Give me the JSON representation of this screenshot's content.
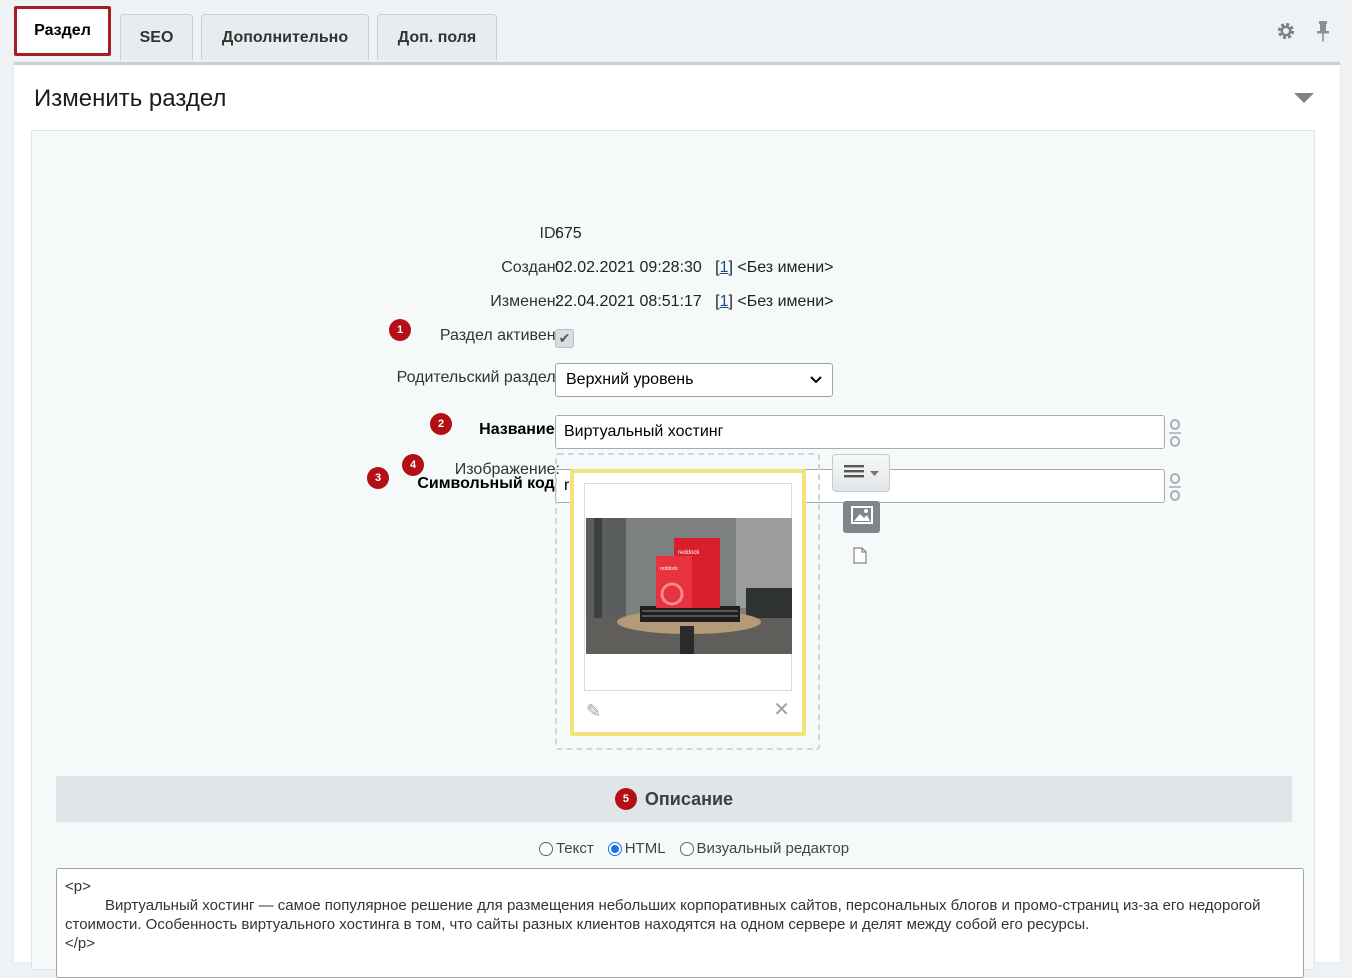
{
  "tabs": [
    {
      "label": "Раздел",
      "active": true
    },
    {
      "label": "SEO",
      "active": false
    },
    {
      "label": "Дополнительно",
      "active": false
    },
    {
      "label": "Доп. поля",
      "active": false
    }
  ],
  "header": {
    "title": "Изменить раздел"
  },
  "fields": {
    "id": {
      "label": "ID:",
      "value": "675"
    },
    "created": {
      "label": "Создан:",
      "value": "02.02.2021 09:28:30",
      "user_id": "1",
      "user_name": "<Без имени>"
    },
    "modified": {
      "label": "Изменен:",
      "value": "22.04.2021 08:51:17",
      "user_id": "1",
      "user_name": "<Без имени>"
    },
    "active": {
      "label": "Раздел активен:",
      "checked": true,
      "badge": "1"
    },
    "parent": {
      "label": "Родительский раздел:",
      "value": "Верхний уровень"
    },
    "name": {
      "label": "Название:",
      "value": "Виртуальный хостинг",
      "badge": "2"
    },
    "code": {
      "label": "Символьный код:",
      "value": "reddock-virtualnyy-khosting",
      "badge": "3"
    },
    "image": {
      "label": "Изображение:",
      "badge": "4"
    }
  },
  "image_photo": {
    "brand_text_1": "reddock",
    "brand_text_2": "reddock"
  },
  "description": {
    "title": "Описание",
    "badge": "5",
    "modes": [
      {
        "label": "Текст",
        "checked": false
      },
      {
        "label": "HTML",
        "checked": true
      },
      {
        "label": "Визуальный редактор",
        "checked": false
      }
    ],
    "line_open": "<p>",
    "line_text": "Виртуальный хостинг — самое популярное решение для размещения небольших корпоративных сайтов, персональных блогов и промо-страниц из-за его недорогой стоимости. Особенность виртуального хостинга в том, что сайты разных клиентов находятся на одном сервере и делят между собой его ресурсы.",
    "line_close": "</p>"
  },
  "colors": {
    "badge": "#b40f14",
    "active_tab_border": "#a51d24",
    "image_card_border": "#f5e17a",
    "link": "#1b4d8c"
  }
}
